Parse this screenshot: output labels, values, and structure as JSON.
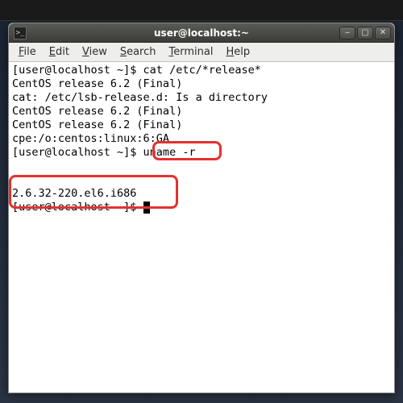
{
  "window": {
    "title": "user@localhost:~"
  },
  "menubar": {
    "items": [
      {
        "key": "F",
        "rest": "ile"
      },
      {
        "key": "E",
        "rest": "dit"
      },
      {
        "key": "V",
        "rest": "iew"
      },
      {
        "key": "S",
        "rest": "earch"
      },
      {
        "key": "T",
        "rest": "erminal"
      },
      {
        "key": "H",
        "rest": "elp"
      }
    ]
  },
  "terminal": {
    "lines": [
      "[user@localhost ~]$ cat /etc/*release*",
      "CentOS release 6.2 (Final)",
      "cat: /etc/lsb-release.d: Is a directory",
      "CentOS release 6.2 (Final)",
      "CentOS release 6.2 (Final)",
      "cpe:/o:centos:linux:6:GA",
      "[user@localhost ~]$ uname -r",
      "",
      "",
      "2.6.32-220.el6.i686",
      "[user@localhost ~]$ "
    ]
  },
  "titlebar_controls": {
    "minimize": "–",
    "maximize": "▢",
    "close": "✕"
  },
  "highlight": {
    "command": "uname -r",
    "output": "2.6.32-220.el6.i686"
  }
}
